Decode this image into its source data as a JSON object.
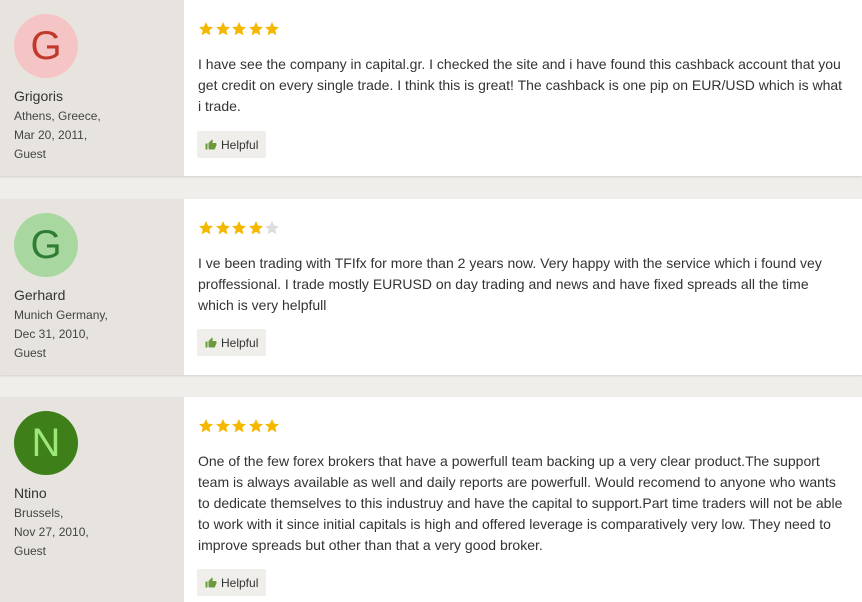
{
  "reviews": [
    {
      "initial": "G",
      "avatar_bg": "#f5c4c4",
      "avatar_fg": "#c0392b",
      "name": "Grigoris",
      "location": "Athens, Greece,",
      "date": "Mar 20, 2011,",
      "role": "Guest",
      "rating": 5,
      "text": "I have see the company in capital.gr. I checked the site and i have found this cashback account that you get credit on every single trade. I think this is great! The cashback is one pip on EUR/USD which is what i trade.",
      "helpful_label": "Helpful"
    },
    {
      "initial": "G",
      "avatar_bg": "#a8d8a0",
      "avatar_fg": "#2e7d32",
      "name": "Gerhard",
      "location": "Munich Germany,",
      "date": "Dec 31, 2010,",
      "role": "Guest",
      "rating": 4,
      "text": "I ve been trading with TFIfx for more than 2 years now. Very happy with the service which i found vey proffessional. I trade mostly EURUSD on day trading and news and have fixed spreads all the time which is very helpfull",
      "helpful_label": "Helpful"
    },
    {
      "initial": "N",
      "avatar_bg": "#3f7f1a",
      "avatar_fg": "#9ee87a",
      "name": "Ntino",
      "location": "Brussels,",
      "date": "Nov 27, 2010,",
      "role": "Guest",
      "rating": 5,
      "text": "One of the few forex brokers that have a powerfull team backing up a very clear product.The support team is always available as well and daily reports are powerfull. Would recomend to anyone who wants to dedicate themselves to this industruy and have the capital to support.Part time traders will not be able to work with it since initial capitals is high and offered leverage is comparatively very low. They need to improve spreads but other than that a very good broker.",
      "helpful_label": "Helpful"
    }
  ],
  "colors": {
    "star_filled": "#f5b800",
    "star_empty": "#dddddd",
    "thumb": "#6a9a3a"
  }
}
